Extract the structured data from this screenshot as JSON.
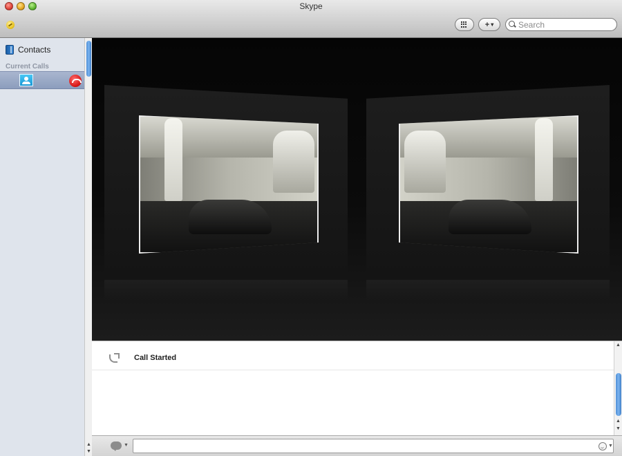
{
  "window": {
    "title": "Skype"
  },
  "toolbar": {
    "add_label": "+",
    "add_caret": "▾",
    "search_placeholder": "Search"
  },
  "sidebar": {
    "contacts_label": "Contacts",
    "section_label": "Current Calls"
  },
  "chat": {
    "events": [
      {
        "icon": "call-started-icon",
        "text": "Call Started"
      }
    ],
    "message_value": ""
  },
  "colors": {
    "video_background": "#050505",
    "sidebar_background": "#dfe4ec",
    "selected_row": "#98a8c6",
    "hangup": "#d81818",
    "scroll_thumb": "#4f8fd6"
  },
  "icons": [
    "status-icon",
    "dialpad-icon",
    "add-icon",
    "search-icon",
    "contacts-icon",
    "conference-icon",
    "hangup-icon",
    "call-started-icon",
    "chat-mode-icon",
    "emoticon-icon"
  ]
}
